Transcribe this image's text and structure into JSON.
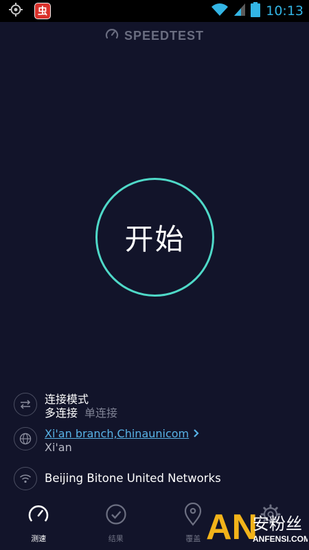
{
  "status_bar": {
    "time": "10:13",
    "app_badge": "虫",
    "icons": [
      "gps-icon",
      "app-notification-icon",
      "wifi-icon",
      "signal-icon",
      "battery-icon"
    ]
  },
  "header": {
    "brand": "SPEEDTEST",
    "icon": "speedometer-icon"
  },
  "go_button": {
    "label": "开始",
    "ring_color": "#4fd9c8"
  },
  "connection_mode": {
    "title": "连接模式",
    "selected": "多连接",
    "alternative": "单连接",
    "icon": "swap-arrows-icon"
  },
  "server": {
    "name": "Xi'an branch,Chinaunicom",
    "location": "Xi'an",
    "icon": "globe-icon"
  },
  "isp": {
    "name": "Beijing Bitone United Networks",
    "icon": "wifi-icon"
  },
  "nav": {
    "items": [
      {
        "label": "测速",
        "icon": "speedometer-icon",
        "active": true
      },
      {
        "label": "结果",
        "icon": "check-circle-icon",
        "active": false
      },
      {
        "label": "覆盖",
        "icon": "map-pin-icon",
        "active": false
      },
      {
        "label": "",
        "icon": "gear-icon",
        "active": false
      }
    ]
  },
  "watermark": {
    "letters": "AN",
    "cn": "安粉丝",
    "site": "ANFENSI.COM"
  },
  "colors": {
    "background": "#12142a",
    "accent_teal": "#4fd9c8",
    "link_blue": "#58b2e6",
    "status_blue": "#33b5e5"
  }
}
